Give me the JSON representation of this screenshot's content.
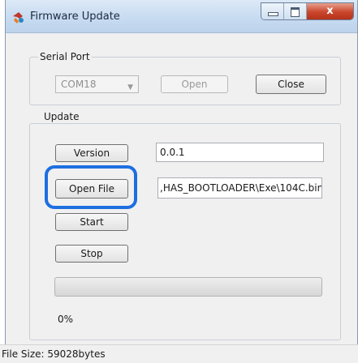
{
  "window": {
    "title": "Firmware Update",
    "close_glyph": "x"
  },
  "serial_port": {
    "group_label": "Serial Port",
    "port_value": "COM18",
    "open_label": "Open",
    "close_label": "Close"
  },
  "update": {
    "group_label": "Update",
    "version_label": "Version",
    "version_value": "0.0.1",
    "open_file_label": "Open File",
    "file_path": ",HAS_BOOTLOADER\\Exe\\104C.bin",
    "start_label": "Start",
    "stop_label": "Stop",
    "progress": 0,
    "progress_text": "0%"
  },
  "status": {
    "file_size": "File Size: 59028bytes"
  },
  "colors": {
    "highlight": "#1d6fe0",
    "title_bar": "#c9dcf1",
    "close_button": "#c9452b"
  },
  "icons": [
    "app-icon",
    "minimize-icon",
    "maximize-icon",
    "close-icon",
    "dropdown-arrow-icon"
  ]
}
